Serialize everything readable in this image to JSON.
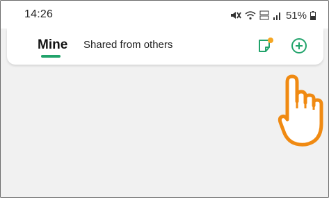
{
  "status_bar": {
    "time": "14:26",
    "icons": [
      "mute-icon",
      "wifi-icon",
      "volte-icon",
      "signal-icon"
    ],
    "battery_percent": "51%"
  },
  "header": {
    "tabs": [
      {
        "label": "Mine",
        "active": true
      },
      {
        "label": "Shared from others",
        "active": false
      }
    ],
    "actions": [
      "note-icon",
      "add-circle-icon"
    ]
  },
  "colors": {
    "accent": "#21a36b",
    "notification_dot": "#f5a623",
    "pointer_hand": "#f08a12",
    "content_background": "#f1f1f1"
  }
}
